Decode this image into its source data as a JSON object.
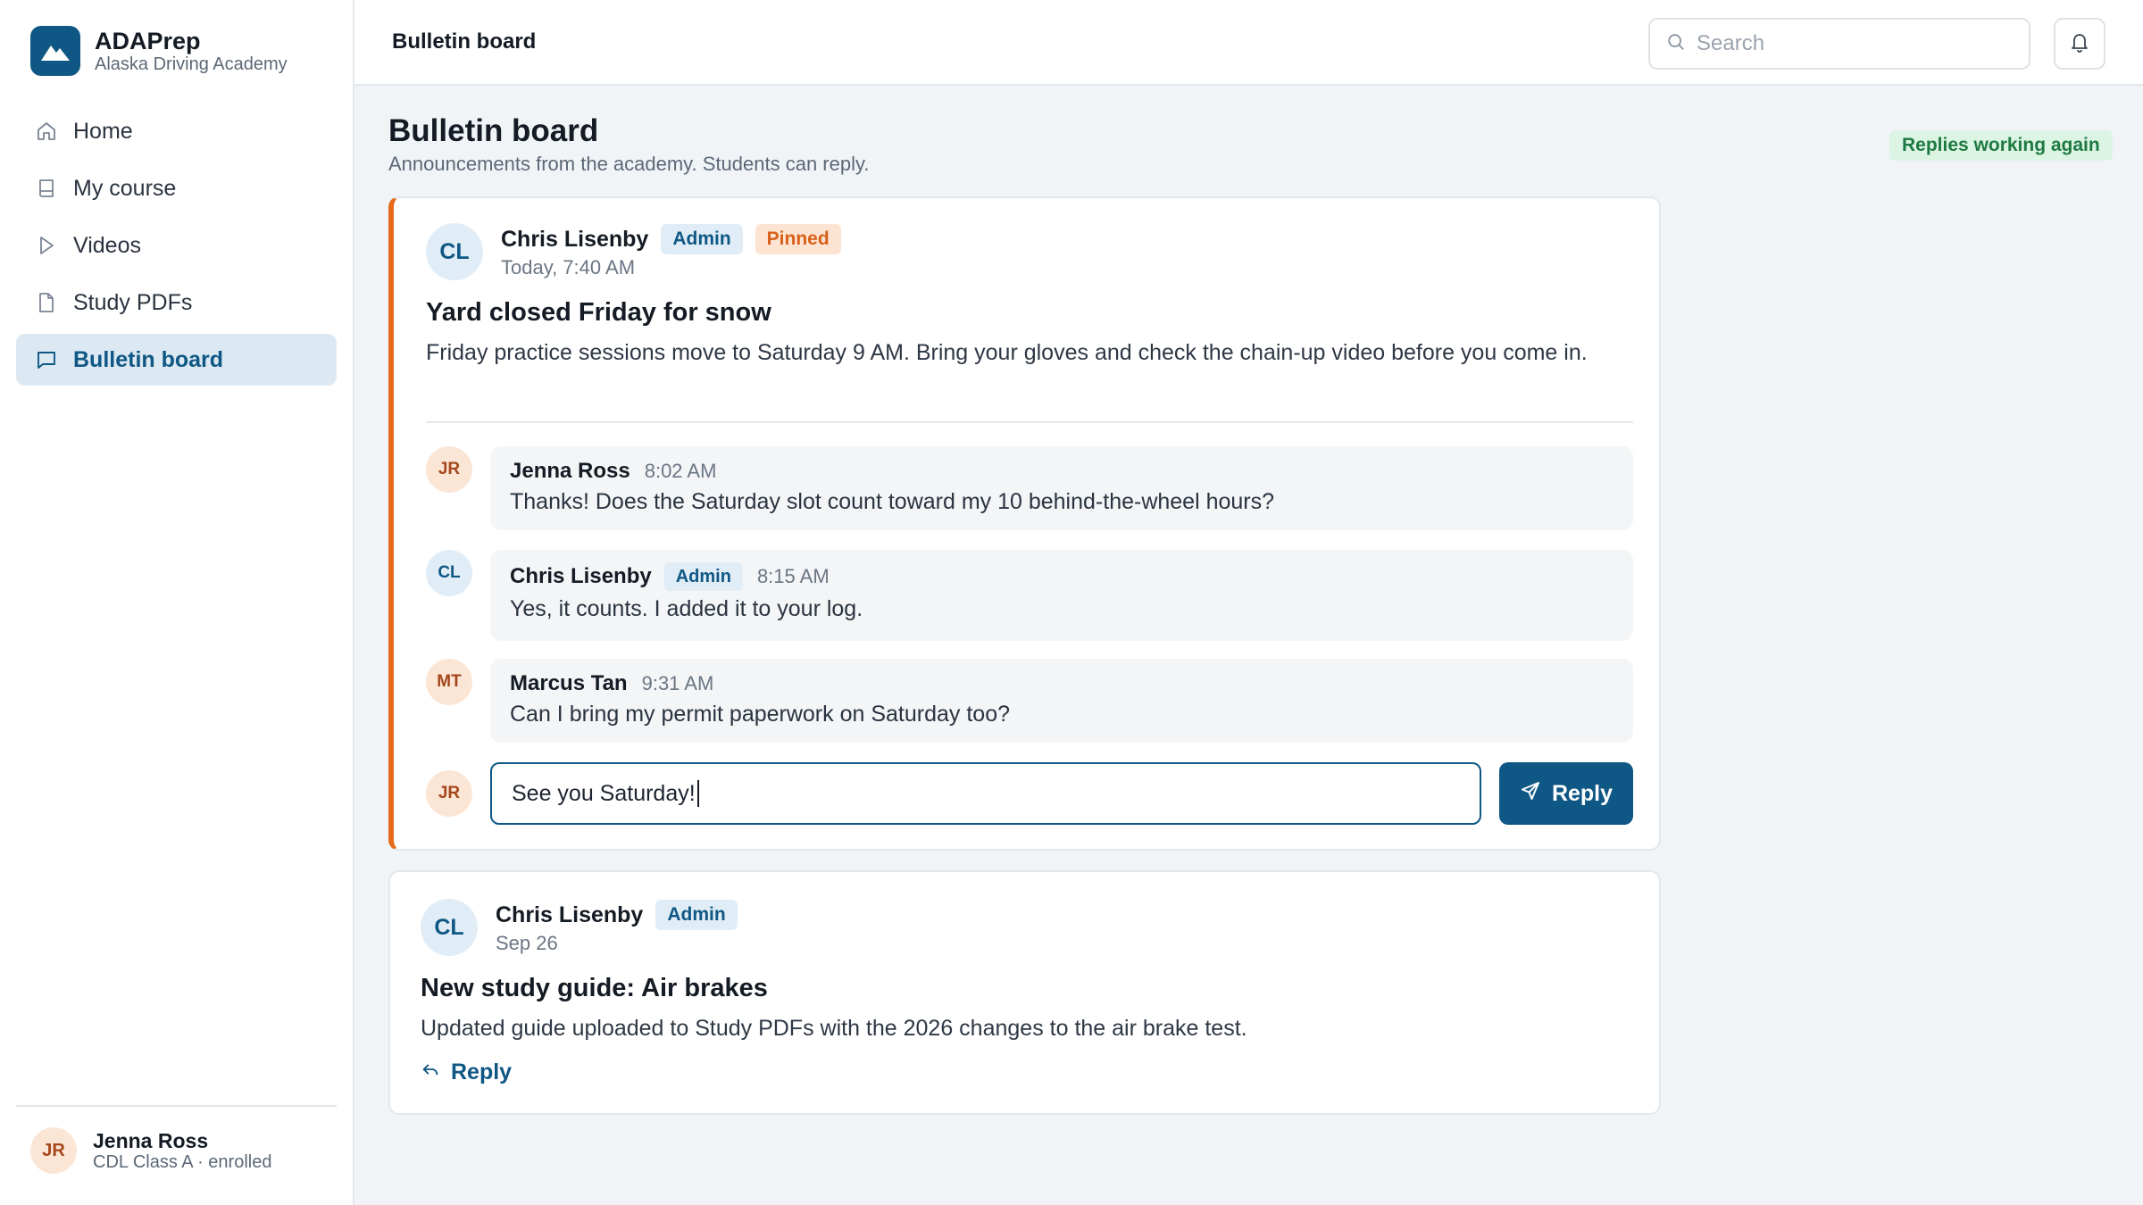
{
  "brand": {
    "name": "ADAPrep",
    "subtitle": "Alaska Driving Academy"
  },
  "nav": {
    "items": [
      {
        "label": "Home",
        "icon": "home-icon"
      },
      {
        "label": "My course",
        "icon": "book-icon"
      },
      {
        "label": "Videos",
        "icon": "play-icon"
      },
      {
        "label": "Study PDFs",
        "icon": "file-icon"
      },
      {
        "label": "Bulletin board",
        "icon": "message-icon",
        "active": true
      }
    ]
  },
  "profile": {
    "initials": "JR",
    "name": "Jenna Ross",
    "subtitle": "CDL Class A · enrolled"
  },
  "topbar": {
    "title": "Bulletin board",
    "search_placeholder": "Search"
  },
  "page": {
    "title": "Bulletin board",
    "subtitle": "Announcements from the academy. Students can reply.",
    "status": "Replies working again"
  },
  "posts": [
    {
      "initials": "CL",
      "author": "Chris Lisenby",
      "badge": "Admin",
      "pinned_label": "Pinned",
      "time": "Today, 7:40 AM",
      "title": "Yard closed Friday for snow",
      "body": "Friday practice sessions move to Saturday 9 AM. Bring your gloves and check the chain-up video before you come in.",
      "replies": [
        {
          "initials": "JR",
          "name": "Jenna Ross",
          "time": "8:02 AM",
          "text": "Thanks! Does the Saturday slot count toward my 10 behind-the-wheel hours?"
        },
        {
          "initials": "CL",
          "name": "Chris Lisenby",
          "badge": "Admin",
          "time": "8:15 AM",
          "text": "Yes, it counts. I added it to your log."
        },
        {
          "initials": "MT",
          "name": "Marcus Tan",
          "time": "9:31 AM",
          "text": "Can I bring my permit paperwork on Saturday too?"
        }
      ],
      "compose": {
        "initials": "JR",
        "value": "See you Saturday!",
        "button": "Reply"
      }
    },
    {
      "initials": "CL",
      "author": "Chris Lisenby",
      "badge": "Admin",
      "time": "Sep 26",
      "title": "New study guide: Air brakes",
      "body": "Updated guide uploaded to Study PDFs with the 2026 changes to the air brake test.",
      "reply_link": "Reply"
    }
  ],
  "colors": {
    "brand": "#0f5784",
    "pinned_accent": "#e56a1c",
    "status_green": "#1e7a41"
  }
}
